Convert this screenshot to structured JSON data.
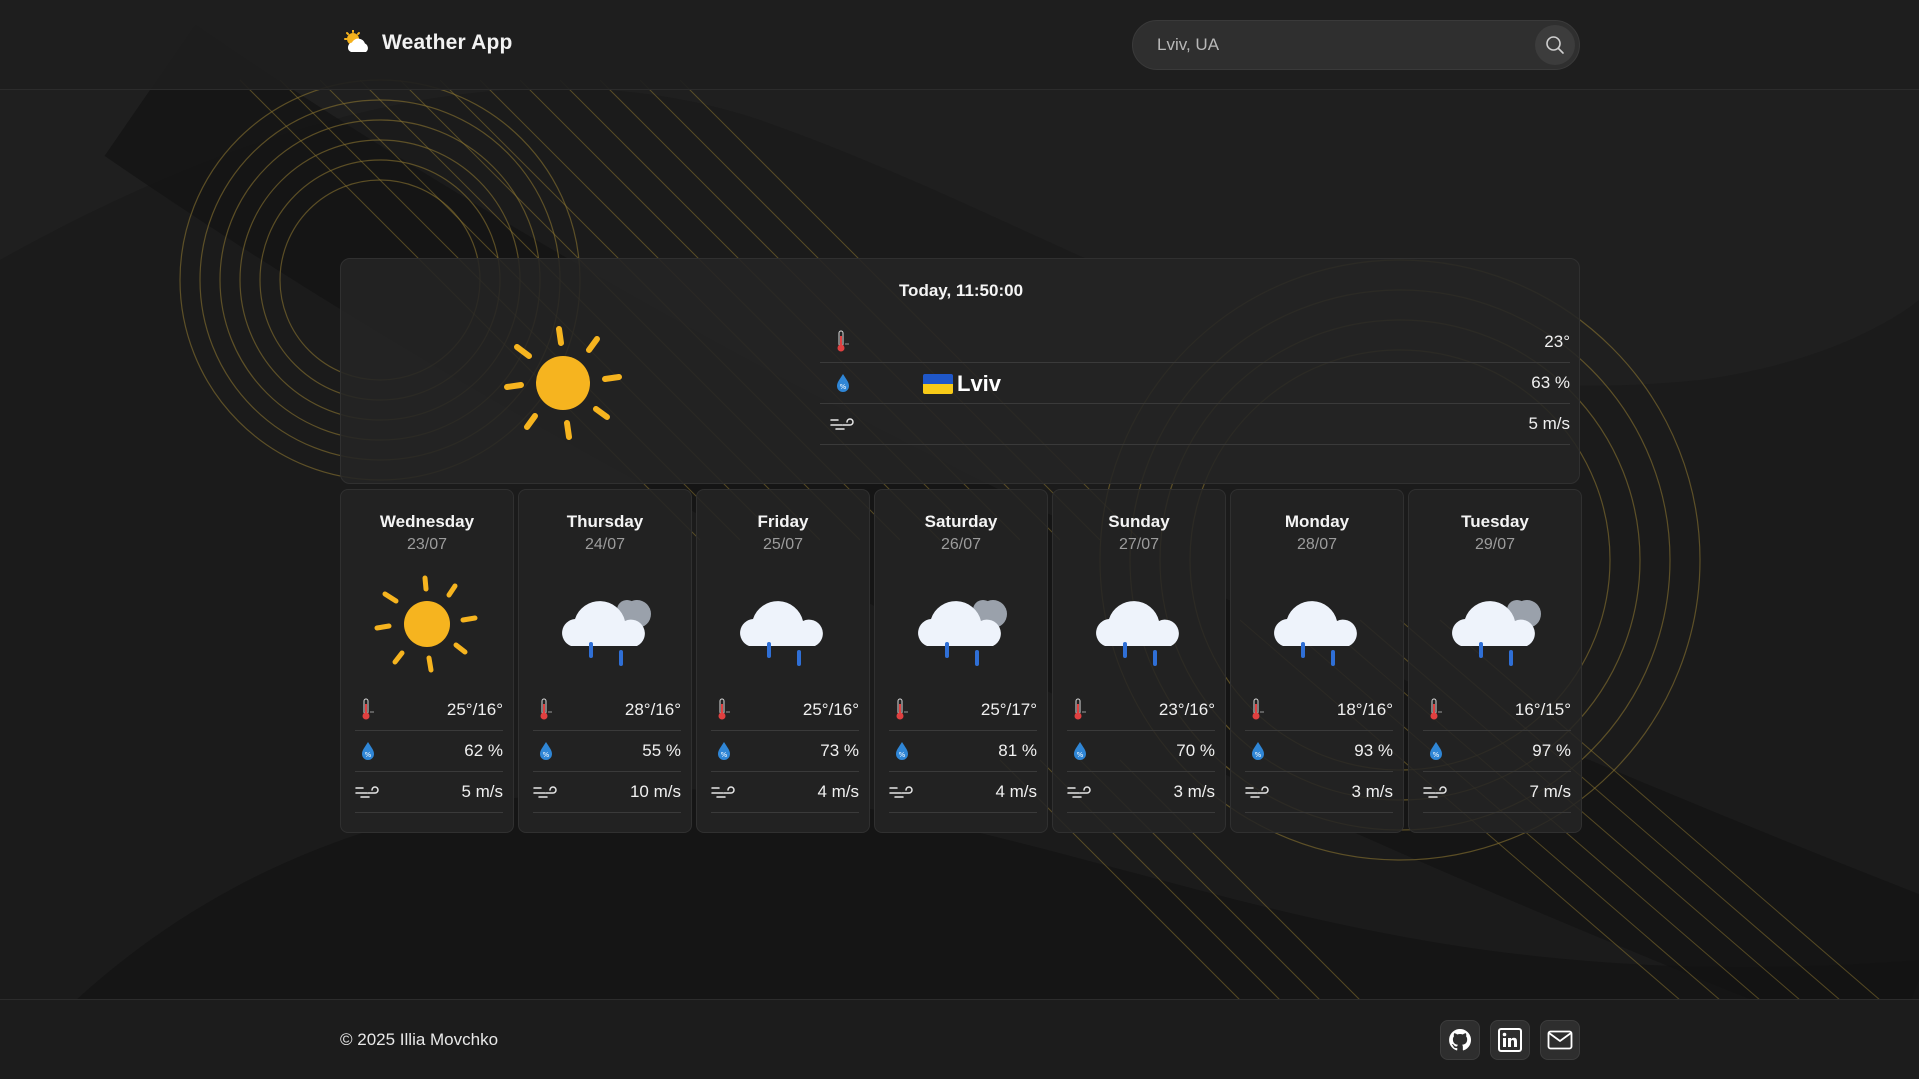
{
  "app": {
    "title": "Weather App"
  },
  "search": {
    "value": "Lviv, UA",
    "placeholder": "Lviv, UA"
  },
  "today": {
    "title": "Today, 11:50:00",
    "city": "Lviv",
    "country_flag": "ukraine-flag",
    "condition_icon": "sun-icon",
    "temperature": "23°",
    "humidity": "63 %",
    "wind": "5 m/s"
  },
  "forecast": [
    {
      "day": "Wednesday",
      "date": "23/07",
      "icon": "sun-icon",
      "temp": "25°/16°",
      "humidity": "62 %",
      "wind": "5 m/s"
    },
    {
      "day": "Thursday",
      "date": "24/07",
      "icon": "rain-cloud-icon",
      "temp": "28°/16°",
      "humidity": "55 %",
      "wind": "10 m/s"
    },
    {
      "day": "Friday",
      "date": "25/07",
      "icon": "rain-cloud-icon",
      "temp": "25°/16°",
      "humidity": "73 %",
      "wind": "4 m/s"
    },
    {
      "day": "Saturday",
      "date": "26/07",
      "icon": "rain-cloud-icon",
      "temp": "25°/17°",
      "humidity": "81 %",
      "wind": "4 m/s"
    },
    {
      "day": "Sunday",
      "date": "27/07",
      "icon": "rain-cloud-icon",
      "temp": "23°/16°",
      "humidity": "70 %",
      "wind": "3 m/s"
    },
    {
      "day": "Monday",
      "date": "28/07",
      "icon": "rain-cloud-icon",
      "temp": "18°/16°",
      "humidity": "93 %",
      "wind": "3 m/s"
    },
    {
      "day": "Tuesday",
      "date": "29/07",
      "icon": "rain-cloud-icon",
      "temp": "16°/15°",
      "humidity": "97 %",
      "wind": "7 m/s"
    }
  ],
  "footer": {
    "copyright": "© 2025 Illia Movchko",
    "links": [
      "github-icon",
      "linkedin-icon",
      "mail-icon"
    ]
  },
  "colors": {
    "accent": "#f5b21d",
    "background": "#1a1a1a",
    "card": "#242424",
    "water": "#2f86d6",
    "thermo": "#e04040"
  }
}
